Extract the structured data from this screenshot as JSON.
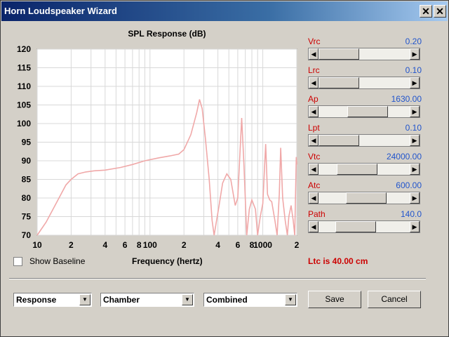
{
  "window": {
    "title": "Horn Loudspeaker Wizard",
    "close_glyph": "✕"
  },
  "chart_data": {
    "type": "line",
    "title": "SPL Response (dB)",
    "xlabel": "Frequency (hertz)",
    "ylabel": "",
    "xscale": "log",
    "xlim": [
      10,
      2000
    ],
    "ylim": [
      70,
      120
    ],
    "yticks": [
      "70",
      "75",
      "80",
      "85",
      "90",
      "95",
      "100",
      "105",
      "110",
      "115",
      "120"
    ],
    "xticks": [
      {
        "v": 10,
        "label": "10"
      },
      {
        "v": 20,
        "label": "2"
      },
      {
        "v": 40,
        "label": "4"
      },
      {
        "v": 60,
        "label": "6"
      },
      {
        "v": 80,
        "label": "8"
      },
      {
        "v": 100,
        "label": "100"
      },
      {
        "v": 200,
        "label": "2"
      },
      {
        "v": 400,
        "label": "4"
      },
      {
        "v": 600,
        "label": "6"
      },
      {
        "v": 800,
        "label": "8"
      },
      {
        "v": 1000,
        "label": "1000"
      },
      {
        "v": 2000,
        "label": "2"
      }
    ],
    "line_color": "#f0a8a8",
    "grid": true,
    "series": [
      {
        "points": [
          [
            10,
            70
          ],
          [
            12,
            73.5
          ],
          [
            15,
            79
          ],
          [
            18,
            83.5
          ],
          [
            20,
            85
          ],
          [
            23,
            86.5
          ],
          [
            27,
            87
          ],
          [
            32,
            87.3
          ],
          [
            40,
            87.5
          ],
          [
            55,
            88.2
          ],
          [
            70,
            89
          ],
          [
            90,
            90
          ],
          [
            120,
            90.8
          ],
          [
            150,
            91.3
          ],
          [
            180,
            91.8
          ],
          [
            200,
            93
          ],
          [
            230,
            97
          ],
          [
            260,
            103
          ],
          [
            275,
            106.5
          ],
          [
            290,
            104
          ],
          [
            310,
            96
          ],
          [
            335,
            85
          ],
          [
            355,
            74
          ],
          [
            370,
            70
          ],
          [
            410,
            78
          ],
          [
            440,
            84
          ],
          [
            480,
            86.5
          ],
          [
            520,
            85
          ],
          [
            570,
            78
          ],
          [
            600,
            80
          ],
          [
            650,
            101.5
          ],
          [
            680,
            89
          ],
          [
            720,
            70
          ],
          [
            760,
            77
          ],
          [
            800,
            79.5
          ],
          [
            860,
            77
          ],
          [
            900,
            70
          ],
          [
            950,
            75
          ],
          [
            1000,
            78.5
          ],
          [
            1060,
            94.5
          ],
          [
            1100,
            81
          ],
          [
            1150,
            79.5
          ],
          [
            1200,
            79
          ],
          [
            1280,
            74
          ],
          [
            1340,
            70
          ],
          [
            1400,
            81
          ],
          [
            1440,
            93.5
          ],
          [
            1500,
            80
          ],
          [
            1580,
            74
          ],
          [
            1650,
            70
          ],
          [
            1700,
            75
          ],
          [
            1780,
            78
          ],
          [
            1860,
            74
          ],
          [
            1920,
            70
          ],
          [
            1980,
            91
          ],
          [
            2000,
            89
          ]
        ]
      }
    ]
  },
  "params": [
    {
      "name": "Vrc",
      "value": "0.20",
      "level": 0.0
    },
    {
      "name": "Lrc",
      "value": "0.10",
      "level": 0.0
    },
    {
      "name": "Ap",
      "value": "1630.00",
      "level": 0.57
    },
    {
      "name": "Lpt",
      "value": "0.10",
      "level": 0.0
    },
    {
      "name": "Vtc",
      "value": "24000.00",
      "level": 0.36
    },
    {
      "name": "Atc",
      "value": "600.00",
      "level": 0.54
    },
    {
      "name": "Path",
      "value": "140.0",
      "level": 0.34
    }
  ],
  "status": "Ltc is 40.00 cm",
  "show_baseline": {
    "label": "Show Baseline",
    "checked": false
  },
  "dropdowns": [
    {
      "value": "Response"
    },
    {
      "value": "Chamber"
    },
    {
      "value": "Combined"
    }
  ],
  "buttons": {
    "save": "Save",
    "cancel": "Cancel"
  },
  "glyphs": {
    "left": "◀",
    "right": "▶",
    "down": "▼"
  }
}
